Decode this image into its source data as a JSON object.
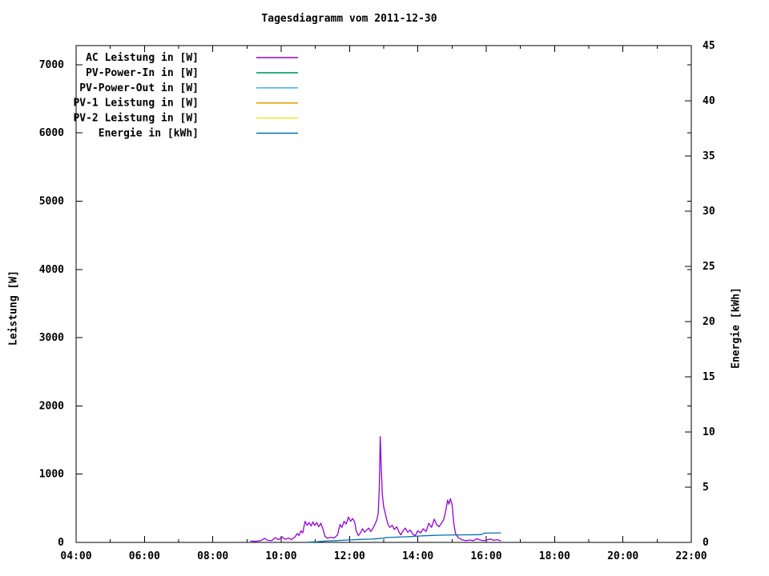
{
  "chart_data": {
    "type": "line",
    "title": "Tagesdiagramm vom 2011-12-30",
    "ylabel": "Leistung [W]",
    "y2label": "Energie [kWh]",
    "xlabel": "",
    "x_range": [
      4,
      22
    ],
    "y_range": [
      0,
      7280
    ],
    "y2_range": [
      0,
      45
    ],
    "x_ticks": [
      "04:00",
      "06:00",
      "08:00",
      "10:00",
      "12:00",
      "14:00",
      "16:00",
      "18:00",
      "20:00",
      "22:00"
    ],
    "y_ticks": [
      0,
      1000,
      2000,
      3000,
      4000,
      5000,
      6000,
      7000
    ],
    "y2_ticks": [
      0,
      5,
      10,
      15,
      20,
      25,
      30,
      35,
      40,
      45
    ],
    "grid": false,
    "legend_position": "top-left-inside",
    "background": "#ffffff",
    "axis_color": "#000000",
    "series": [
      {
        "name": "AC Leistung in [W]",
        "color": "#9400D3",
        "axis": "y1",
        "points": [
          [
            9.11,
            20
          ],
          [
            9.25,
            15
          ],
          [
            9.4,
            25
          ],
          [
            9.52,
            60
          ],
          [
            9.6,
            30
          ],
          [
            9.72,
            25
          ],
          [
            9.83,
            70
          ],
          [
            9.92,
            40
          ],
          [
            10.03,
            80
          ],
          [
            10.12,
            45
          ],
          [
            10.22,
            65
          ],
          [
            10.3,
            40
          ],
          [
            10.4,
            80
          ],
          [
            10.47,
            130
          ],
          [
            10.52,
            100
          ],
          [
            10.58,
            170
          ],
          [
            10.63,
            140
          ],
          [
            10.7,
            310
          ],
          [
            10.76,
            250
          ],
          [
            10.82,
            290
          ],
          [
            10.88,
            240
          ],
          [
            10.93,
            300
          ],
          [
            10.98,
            250
          ],
          [
            11.04,
            290
          ],
          [
            11.1,
            230
          ],
          [
            11.16,
            280
          ],
          [
            11.22,
            200
          ],
          [
            11.28,
            90
          ],
          [
            11.35,
            60
          ],
          [
            11.45,
            75
          ],
          [
            11.55,
            65
          ],
          [
            11.65,
            110
          ],
          [
            11.72,
            260
          ],
          [
            11.78,
            220
          ],
          [
            11.84,
            310
          ],
          [
            11.9,
            270
          ],
          [
            11.97,
            370
          ],
          [
            12.03,
            310
          ],
          [
            12.09,
            350
          ],
          [
            12.15,
            300
          ],
          [
            12.2,
            160
          ],
          [
            12.26,
            100
          ],
          [
            12.32,
            140
          ],
          [
            12.38,
            200
          ],
          [
            12.44,
            150
          ],
          [
            12.5,
            180
          ],
          [
            12.56,
            210
          ],
          [
            12.62,
            160
          ],
          [
            12.68,
            200
          ],
          [
            12.74,
            260
          ],
          [
            12.8,
            330
          ],
          [
            12.84,
            430
          ],
          [
            12.87,
            800
          ],
          [
            12.9,
            1550
          ],
          [
            12.93,
            1080
          ],
          [
            12.96,
            700
          ],
          [
            13.0,
            520
          ],
          [
            13.04,
            440
          ],
          [
            13.08,
            350
          ],
          [
            13.13,
            260
          ],
          [
            13.18,
            220
          ],
          [
            13.25,
            250
          ],
          [
            13.31,
            190
          ],
          [
            13.38,
            230
          ],
          [
            13.44,
            160
          ],
          [
            13.5,
            110
          ],
          [
            13.57,
            170
          ],
          [
            13.63,
            210
          ],
          [
            13.7,
            150
          ],
          [
            13.78,
            180
          ],
          [
            13.85,
            120
          ],
          [
            13.92,
            100
          ],
          [
            14.0,
            170
          ],
          [
            14.08,
            140
          ],
          [
            14.16,
            200
          ],
          [
            14.24,
            160
          ],
          [
            14.32,
            280
          ],
          [
            14.4,
            220
          ],
          [
            14.48,
            340
          ],
          [
            14.55,
            260
          ],
          [
            14.62,
            230
          ],
          [
            14.7,
            290
          ],
          [
            14.76,
            340
          ],
          [
            14.82,
            480
          ],
          [
            14.87,
            620
          ],
          [
            14.91,
            560
          ],
          [
            14.95,
            640
          ],
          [
            15.0,
            560
          ],
          [
            15.05,
            280
          ],
          [
            15.1,
            130
          ],
          [
            15.18,
            70
          ],
          [
            15.28,
            40
          ],
          [
            15.4,
            25
          ],
          [
            15.52,
            35
          ],
          [
            15.62,
            25
          ],
          [
            15.73,
            55
          ],
          [
            15.82,
            35
          ],
          [
            15.92,
            25
          ],
          [
            16.02,
            35
          ],
          [
            16.12,
            50
          ],
          [
            16.22,
            30
          ],
          [
            16.32,
            40
          ],
          [
            16.42,
            25
          ]
        ]
      },
      {
        "name": "PV-Power-In in [W]",
        "color": "#009E73",
        "axis": "y1",
        "points": []
      },
      {
        "name": "PV-Power-Out in [W]",
        "color": "#56B4E9",
        "axis": "y1",
        "points": []
      },
      {
        "name": "PV-1 Leistung in [W]",
        "color": "#E69F00",
        "axis": "y1",
        "points": []
      },
      {
        "name": "PV-2 Leistung in [W]",
        "color": "#F0E442",
        "axis": "y1",
        "points": []
      },
      {
        "name": "Energie in [kWh]",
        "color": "#0072B2",
        "axis": "y2",
        "points": [
          [
            10.78,
            0.02
          ],
          [
            11.05,
            0.06
          ],
          [
            11.3,
            0.12
          ],
          [
            11.6,
            0.16
          ],
          [
            11.95,
            0.22
          ],
          [
            12.3,
            0.27
          ],
          [
            12.65,
            0.3
          ],
          [
            12.95,
            0.38
          ],
          [
            13.1,
            0.44
          ],
          [
            13.4,
            0.48
          ],
          [
            13.75,
            0.52
          ],
          [
            14.05,
            0.58
          ],
          [
            14.4,
            0.63
          ],
          [
            14.8,
            0.66
          ],
          [
            15.2,
            0.68
          ],
          [
            15.85,
            0.7
          ],
          [
            15.95,
            0.84
          ],
          [
            16.42,
            0.86
          ]
        ]
      }
    ]
  }
}
